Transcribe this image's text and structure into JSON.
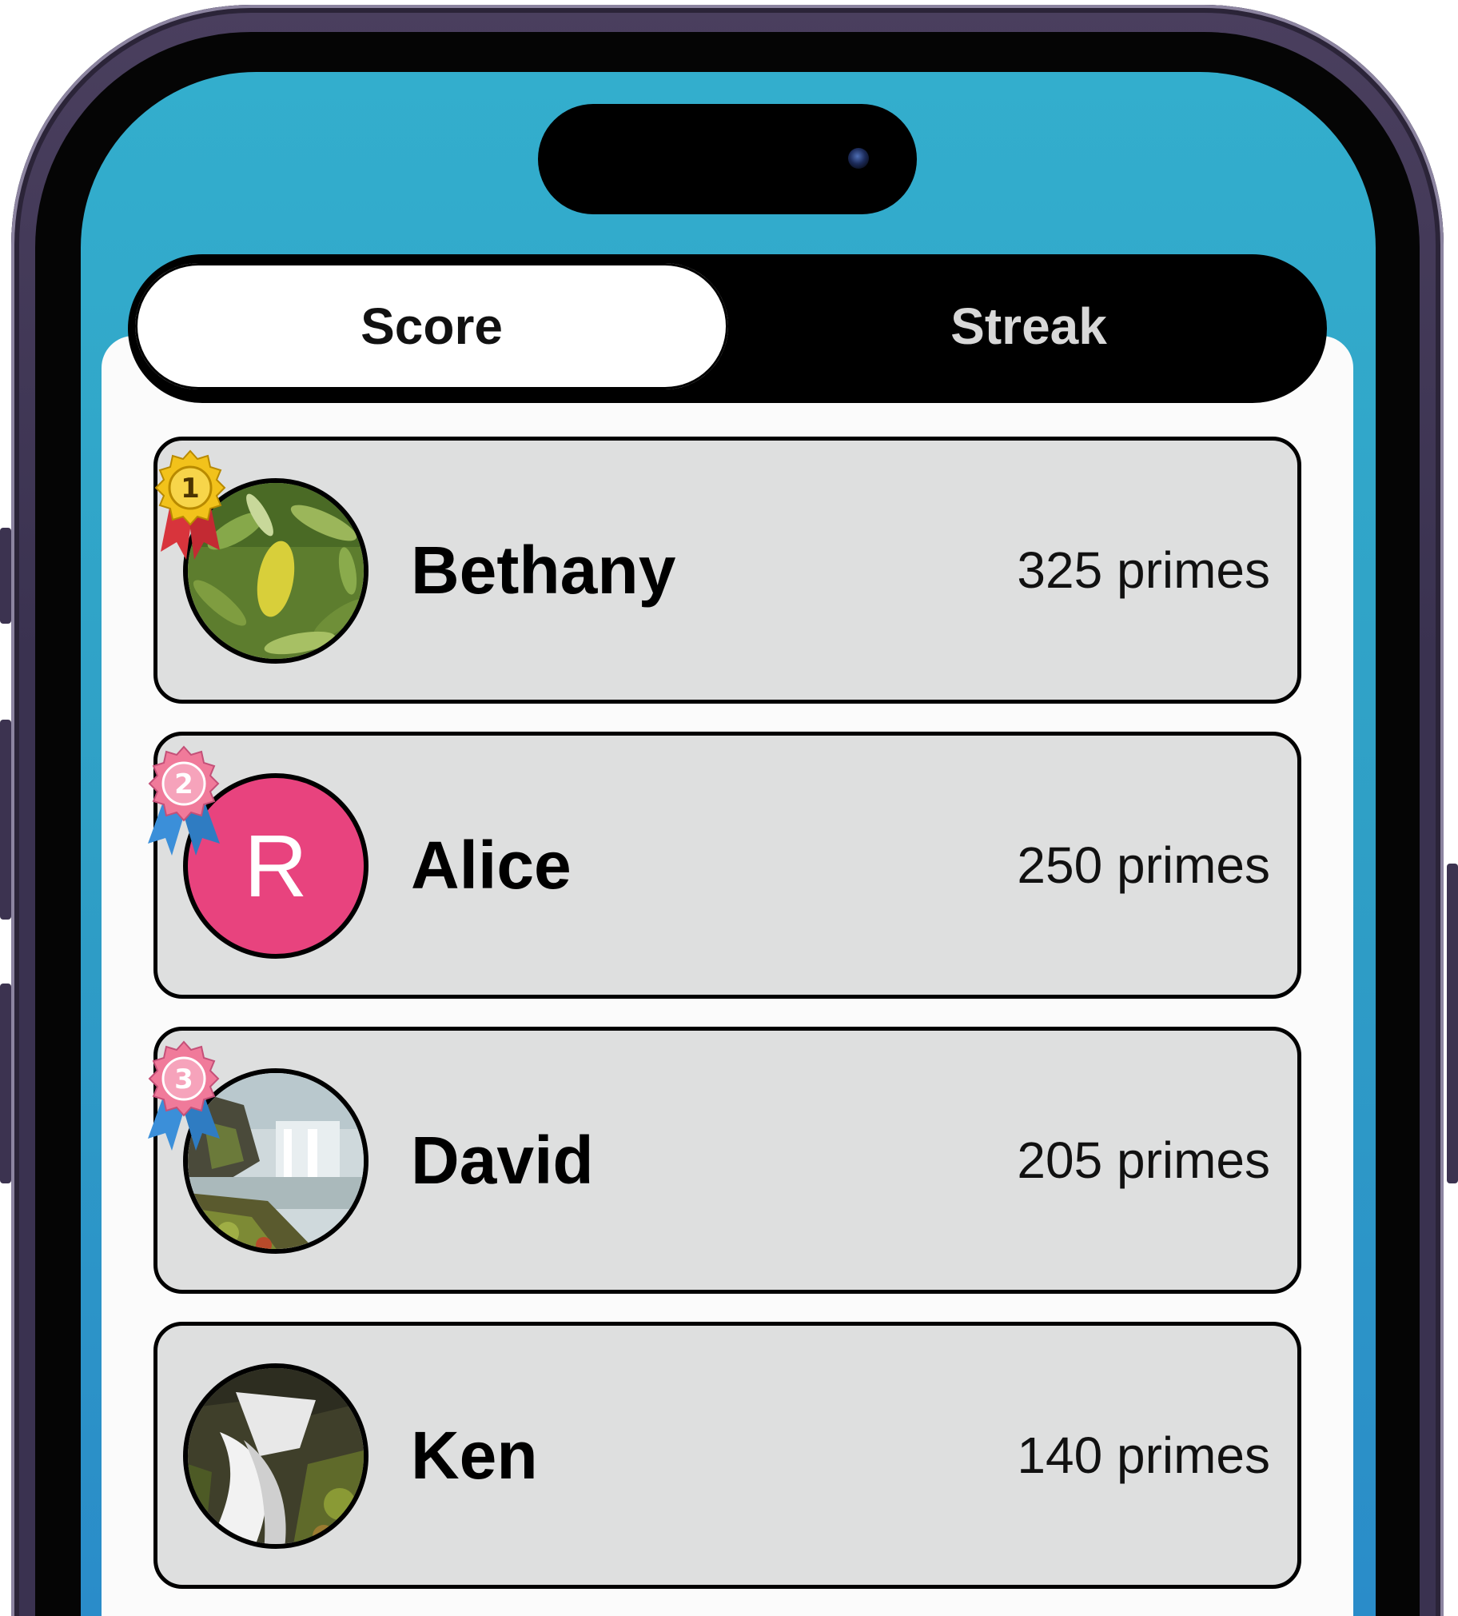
{
  "tabs": [
    {
      "label": "Score",
      "selected": true
    },
    {
      "label": "Streak",
      "selected": false
    }
  ],
  "leaderboard": [
    {
      "rank": "1",
      "name": "Bethany",
      "score": "325 primes",
      "avatar": "leaf-photo",
      "medal_color": "#f2c21b",
      "ribbon_color": "#d8343c"
    },
    {
      "rank": "2",
      "name": "Alice",
      "score": "250 primes",
      "avatar_letter": "R",
      "avatar_color": "#e8437e",
      "medal_color": "#f07a9a",
      "ribbon_color": "#3b8fd9"
    },
    {
      "rank": "3",
      "name": "David",
      "score": "205 primes",
      "avatar": "waterfall-photo",
      "medal_color": "#f07a9a",
      "ribbon_color": "#3b8fd9"
    },
    {
      "name": "Ken",
      "score": "140 primes",
      "avatar": "river-photo"
    }
  ],
  "colors": {
    "background": "#33aecd",
    "row": "#dedfdf",
    "segment_active": "#ffffff",
    "segment_track": "#000000"
  }
}
